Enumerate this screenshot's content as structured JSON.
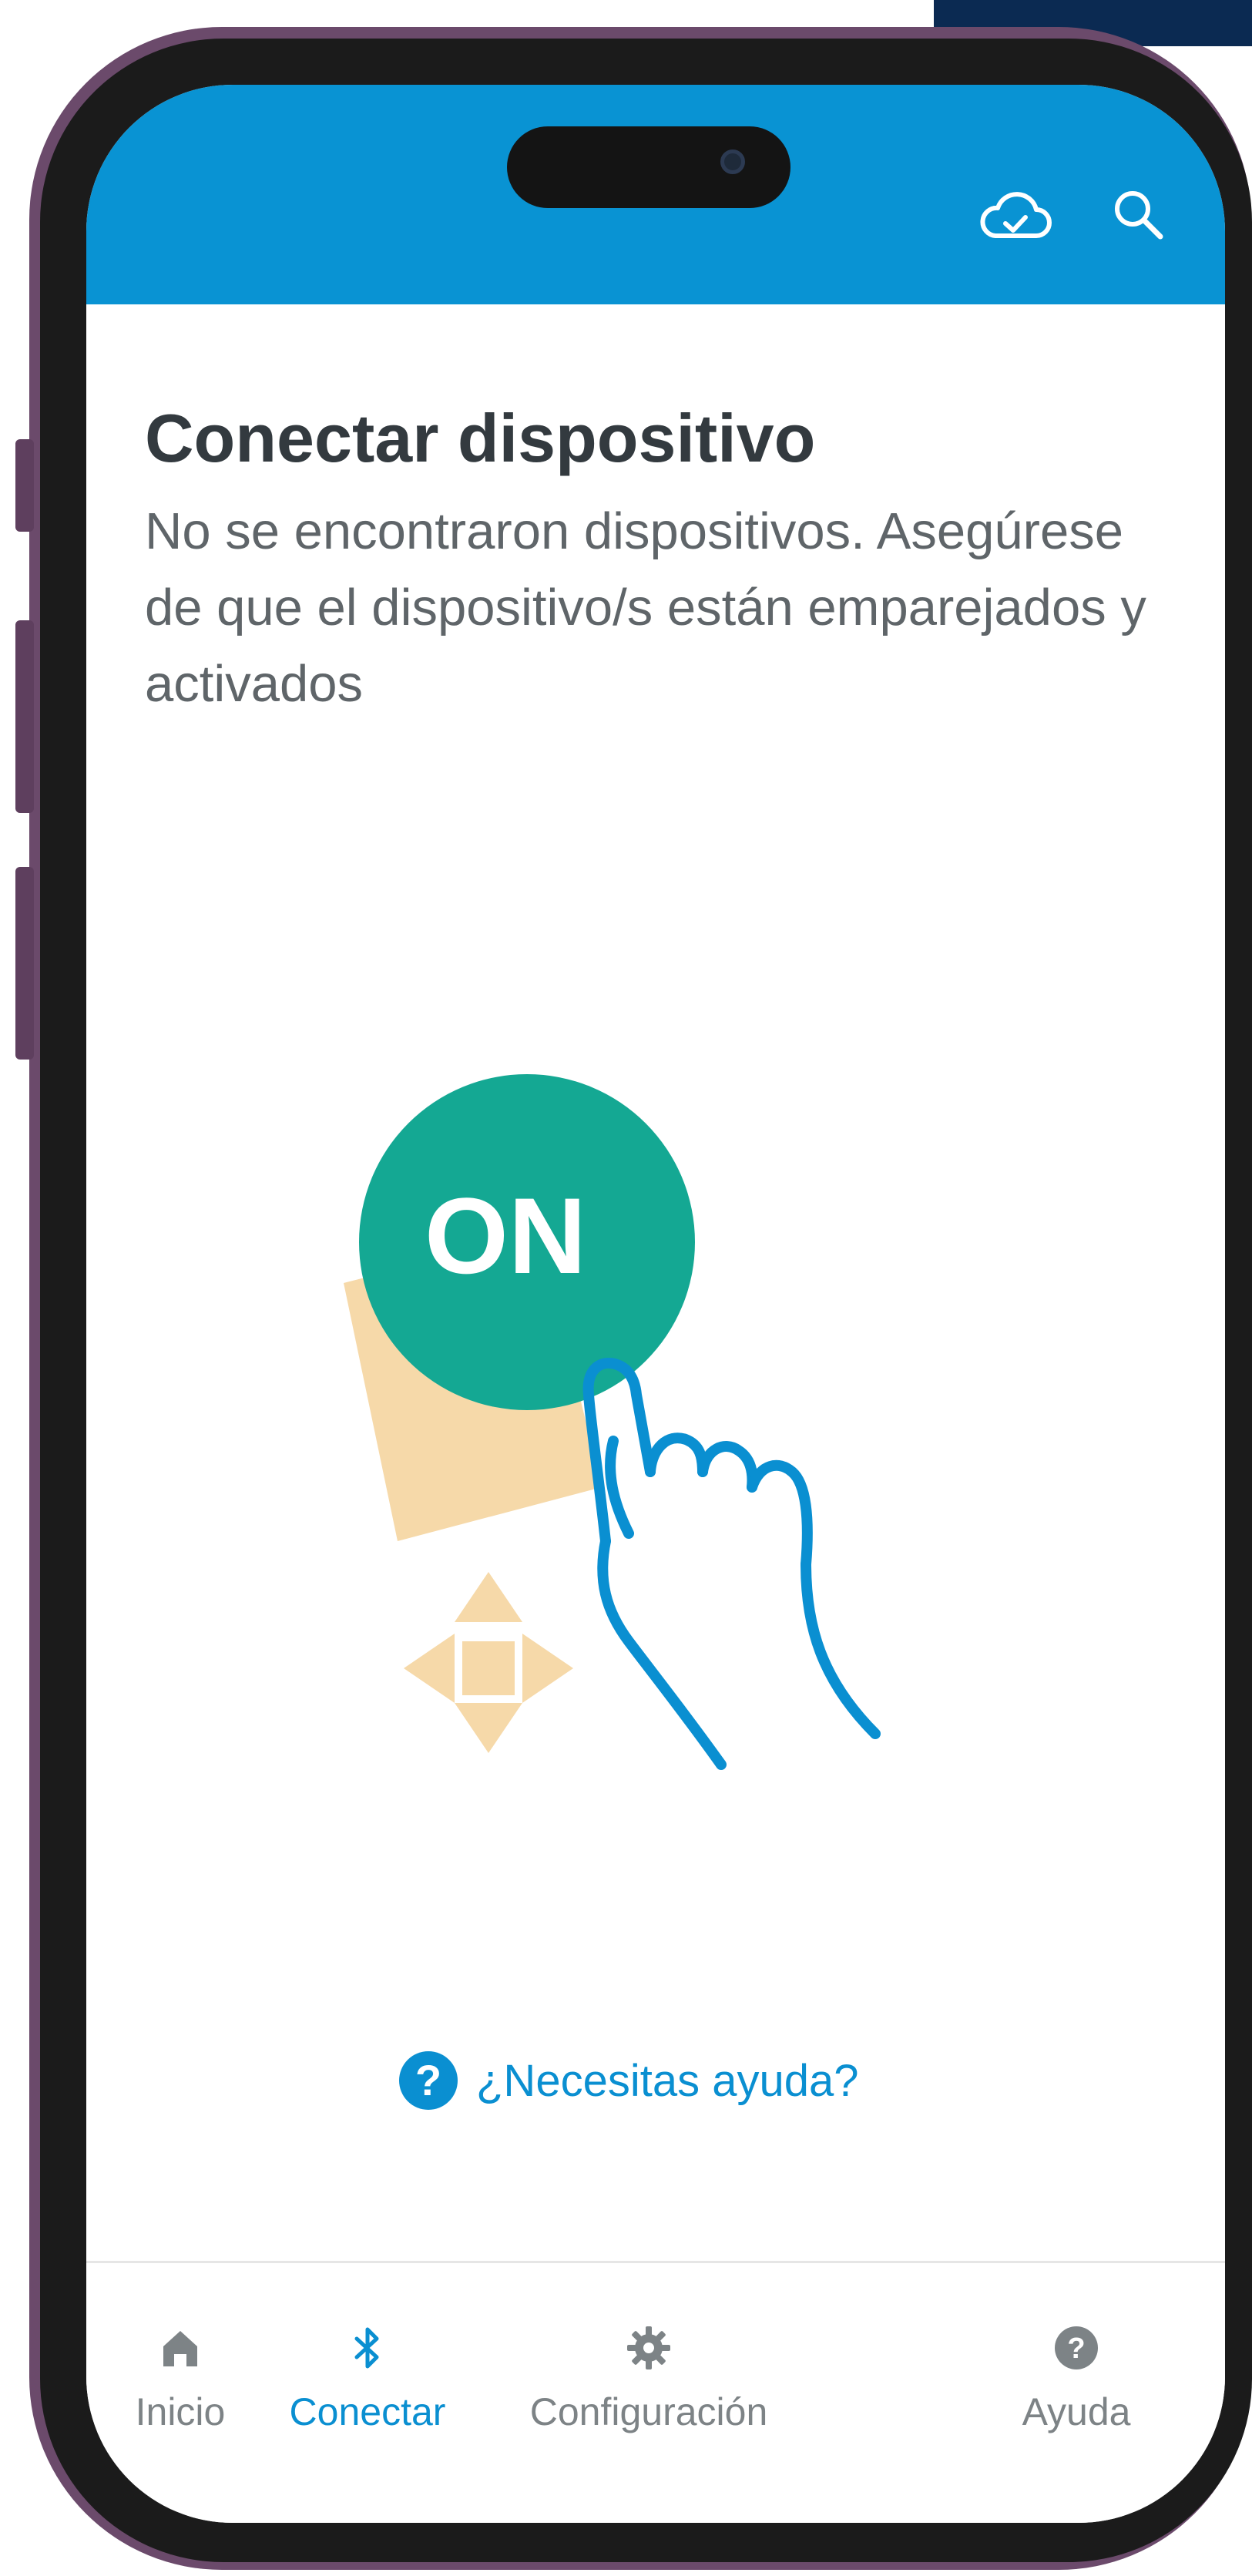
{
  "colors": {
    "header": "#0993d3",
    "accent": "#0a8fd1",
    "title": "#333a3f",
    "body_text": "#5f6569",
    "nav_inactive": "#7d8386",
    "illustration_green": "#14a893",
    "illustration_beige": "#f6d9a9",
    "phone_frame": "#6b4a6b"
  },
  "header": {
    "icons": [
      "cloud-sync-icon",
      "search-icon"
    ]
  },
  "main": {
    "title": "Conectar dispositivo",
    "description": "No se encontraron dispositivos. Asegúrese de que el dispositivo/s están emparejados y activados",
    "illustration": {
      "button_text": "ON",
      "icons": [
        "power-button-icon",
        "hand-pointer-icon",
        "direction-pad-icon"
      ]
    },
    "help_link": {
      "icon": "question-circle-icon",
      "label": "¿Necesitas ayuda?"
    }
  },
  "bottom_nav": {
    "items": [
      {
        "label": "Inicio",
        "icon": "home-icon",
        "active": false
      },
      {
        "label": "Conectar",
        "icon": "bluetooth-icon",
        "active": true
      },
      {
        "label": "Configuración",
        "icon": "gear-icon",
        "active": false
      },
      {
        "label": "Ayuda",
        "icon": "help-circle-icon",
        "active": false
      }
    ]
  }
}
